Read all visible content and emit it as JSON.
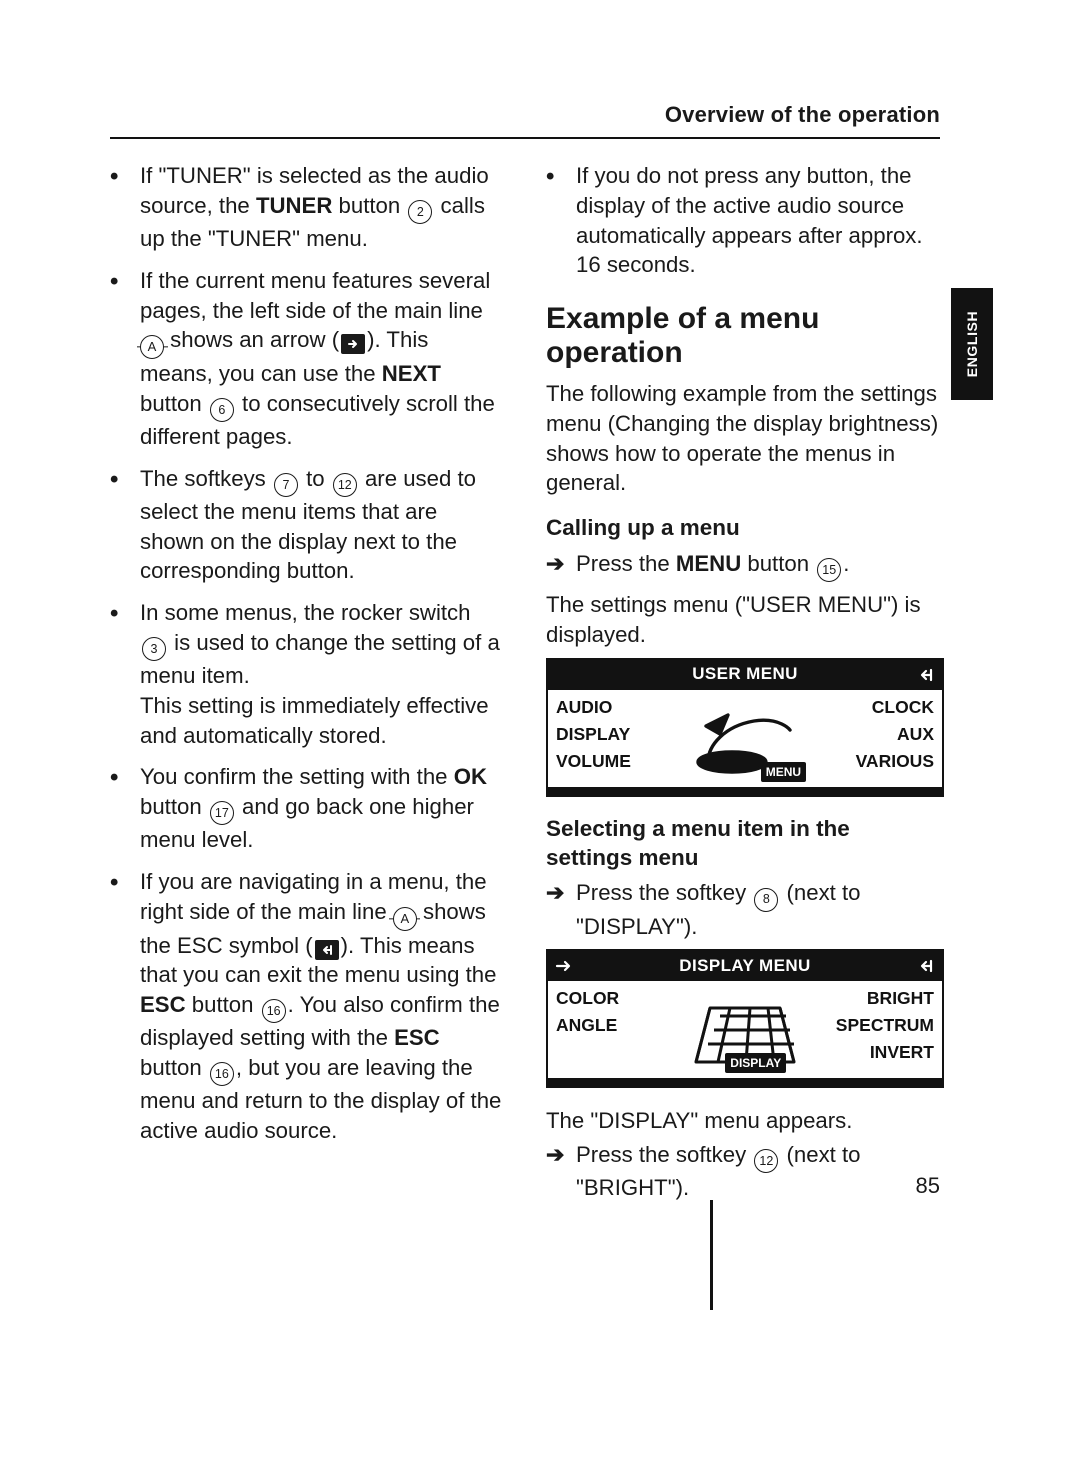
{
  "header": {
    "running_head": "Overview of the operation"
  },
  "language_tab": "ENGLISH",
  "page_number": "85",
  "refs": {
    "letterA": "A",
    "n2": "2",
    "n3": "3",
    "n6": "6",
    "n7": "7",
    "n8": "8",
    "n12": "12",
    "n15": "15",
    "n16": "16",
    "n17": "17"
  },
  "left": {
    "b1_a": "If \"TUNER\" is selected as the audio source, the ",
    "b1_tuner": "TUNER",
    "b1_b": " button ",
    "b1_c": " calls up the \"TUNER\" menu.",
    "b2_a": "If the current menu features several pages, the left side of the main line ",
    "b2_b": " shows an arrow (",
    "b2_c": "). This means, you can use the ",
    "b2_next": "NEXT",
    "b2_d": " button ",
    "b2_e": " to consecutively scroll the different pages.",
    "b3_a": "The softkeys ",
    "b3_b": " to ",
    "b3_c": " are used to select the menu items that are shown on the display next to the corresponding button.",
    "b4_a": "In some menus, the rocker switch ",
    "b4_b": " is used to change the setting of a menu item.",
    "b4_sub": "This setting is immediately effective and automatically stored.",
    "b5_a": "You confirm the setting with the ",
    "b5_ok": "OK",
    "b5_b": " button ",
    "b5_c": " and go back one higher menu level.",
    "b6_a": "If you are navigating in a menu, the right side of the main line ",
    "b6_b": " shows the ESC symbol (",
    "b6_c": "). This means that you can exit the menu using the ",
    "b6_esc": "ESC",
    "b6_d": " button ",
    "b6_e": ". You also confirm the displayed setting with the ",
    "b6_f": " button ",
    "b6_g": ", but you are leaving the menu and return to the display of the active audio source."
  },
  "right": {
    "b1": "If you do not press any button, the display of the active audio source automatically appears after approx. 16 seconds.",
    "h2": "Example of a menu operation",
    "intro": "The following example from the settings menu (Changing the display brightness) shows how to operate the menus in general.",
    "h3a": "Calling up a menu",
    "step1_a": "Press the ",
    "step1_menu": "MENU",
    "step1_b": " button ",
    "step1_c": ".",
    "step1_result": "The settings menu (\"USER MENU\") is displayed.",
    "h3b": "Selecting a menu item in the settings menu",
    "step2_a": "Press the softkey ",
    "step2_b": " (next to \"DISPLAY\").",
    "display_menu_appears": "The \"DISPLAY\" menu appears.",
    "step3_a": "Press the softkey ",
    "step3_b": " (next to \"BRIGHT\")."
  },
  "display1": {
    "title": "USER MENU",
    "left": [
      "AUDIO",
      "DISPLAY",
      "VOLUME"
    ],
    "right": [
      "CLOCK",
      "AUX",
      "VARIOUS"
    ],
    "badge": "MENU"
  },
  "display2": {
    "title": "DISPLAY MENU",
    "left": [
      "COLOR",
      "ANGLE",
      ""
    ],
    "right": [
      "BRIGHT",
      "SPECTRUM",
      "INVERT"
    ],
    "badge": "DISPLAY"
  }
}
